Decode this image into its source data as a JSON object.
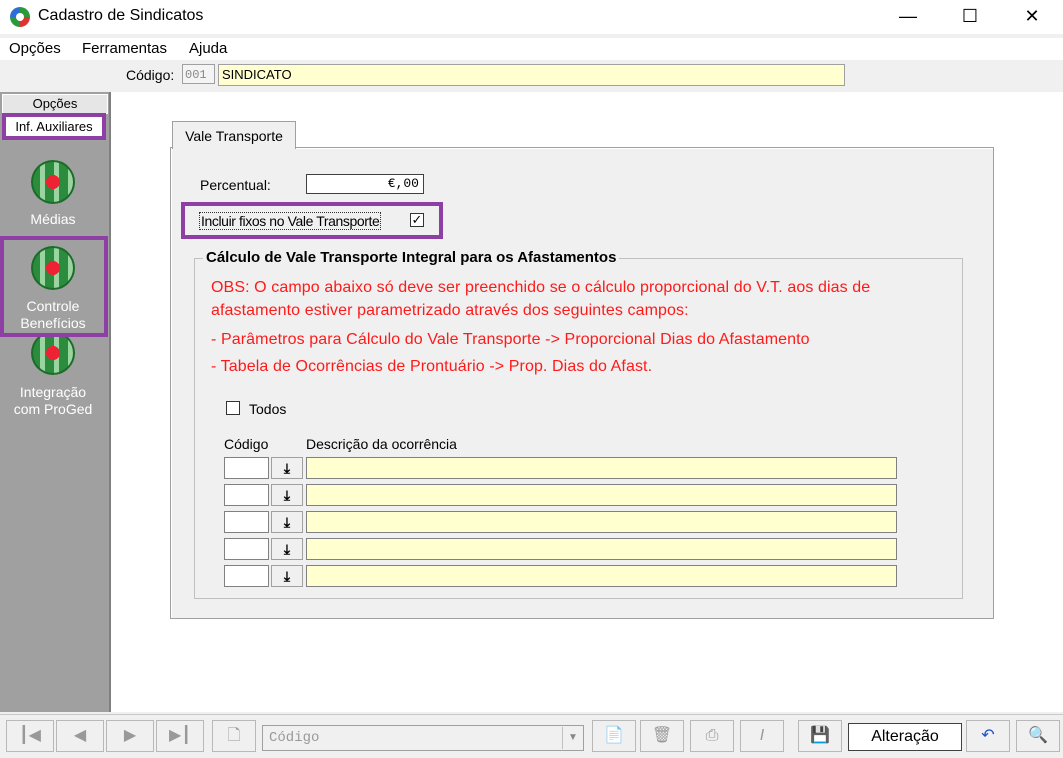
{
  "window": {
    "title": "Cadastro de Sindicatos"
  },
  "menu": {
    "items": [
      "Opções",
      "Ferramentas",
      "Ajuda"
    ]
  },
  "header": {
    "code_label": "Código:",
    "code_value": "001",
    "name_value": "SINDICATO"
  },
  "sidebar": {
    "top_tabs": [
      "Opções",
      "Inf. Auxiliares"
    ],
    "items": [
      {
        "label": "Médias",
        "icon": "globe-icon"
      },
      {
        "label": "Controle Benefícios",
        "icon": "globe-icon"
      },
      {
        "label": "Integração com ProGed",
        "icon": "globe-icon"
      }
    ]
  },
  "tab": {
    "label": "Vale Transporte"
  },
  "form": {
    "percent_label": "Percentual:",
    "percent_value": "€,00",
    "incluir_label": "Incluir fixos no Vale Transporte",
    "incluir_checked": true,
    "group_title": "Cálculo de Vale Transporte Integral para os Afastamentos",
    "obs_lines": [
      "OBS: O campo abaixo só deve ser preenchido se o cálculo proporcional  do  V.T. aos dias de",
      "afastamento estiver parametrizado através dos seguintes campos:",
      "- Parâmetros para Cálculo do Vale Transporte -> Proporcional Dias do Afastamento",
      "- Tabela de Ocorrências de Prontuário -> Prop. Dias do Afast."
    ],
    "todos_label": "Todos",
    "todos_checked": false,
    "col_codigo": "Código",
    "col_descricao": "Descrição da ocorrência",
    "rows": 5
  },
  "toolbar": {
    "combo_value": "Código",
    "status": "Alteração"
  },
  "colors": {
    "highlight": "#8e3fa3",
    "obs_text": "#ff1a1a",
    "field_yellow": "#ffffd0",
    "sidebar_bg": "#a0a0a0"
  }
}
